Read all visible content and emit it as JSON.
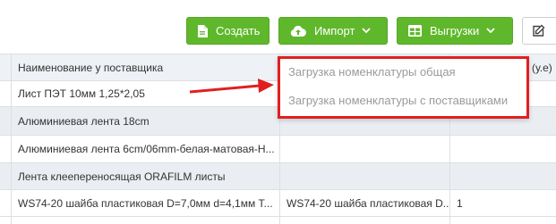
{
  "toolbar": {
    "create_label": "Создать",
    "import_label": "Импорт",
    "export_label": "Выгрузки"
  },
  "table": {
    "header": [
      "Наименование у поставщика",
      "(у.е)"
    ],
    "rows": [
      {
        "name": "Лист ПЭТ 10мм 1,25*2,05",
        "col2": "",
        "col3": ""
      },
      {
        "name": "Алюминиевая лента 18cm",
        "col2": "",
        "col3": ""
      },
      {
        "name": "Алюминиевая лента 6cm/06mm-белая-матовая-Н...",
        "col2": "",
        "col3": ""
      },
      {
        "name": "Лента клеепереносящая ORAFILM листы",
        "col2": "",
        "col3": ""
      },
      {
        "name": "WS74-20 шайба пластиковая D=7,0мм d=4,1мм Т...",
        "col2": "WS74-20 шайба пластиковая D...",
        "col3": "1"
      }
    ]
  },
  "import_menu": {
    "items": [
      "Загрузка номенклатуры общая",
      "Загрузка номенклатуры с поставщиками"
    ]
  },
  "colors": {
    "accent_green": "#5fb82b",
    "highlight_red": "#e02020"
  }
}
